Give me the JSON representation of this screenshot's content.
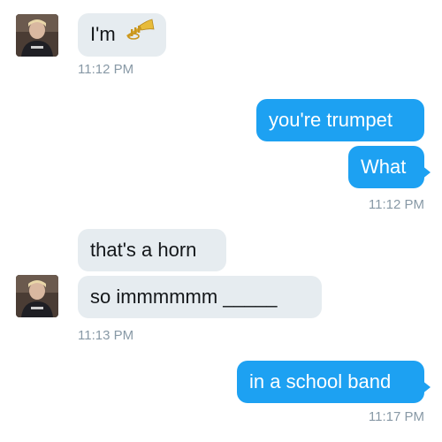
{
  "messages": [
    {
      "side": "in",
      "text": "I'm",
      "emoji": "trumpet-emoji"
    },
    {
      "side": "in",
      "timestamp": "11:12 PM"
    },
    {
      "side": "out",
      "text": "you're trumpet"
    },
    {
      "side": "out",
      "text": "What"
    },
    {
      "side": "out",
      "timestamp": "11:12 PM"
    },
    {
      "side": "in",
      "text": "that's a horn"
    },
    {
      "side": "in",
      "text": "so immmmmm _____"
    },
    {
      "side": "in",
      "timestamp": "11:13 PM"
    },
    {
      "side": "out",
      "text": "in a school band"
    },
    {
      "side": "out",
      "timestamp": "11:17 PM"
    }
  ],
  "colors": {
    "incoming_bubble": "#e6ecf0",
    "outgoing_bubble": "#1da1f2",
    "timestamp": "#8899a6"
  },
  "icons": [
    "avatar",
    "trumpet-emoji"
  ]
}
